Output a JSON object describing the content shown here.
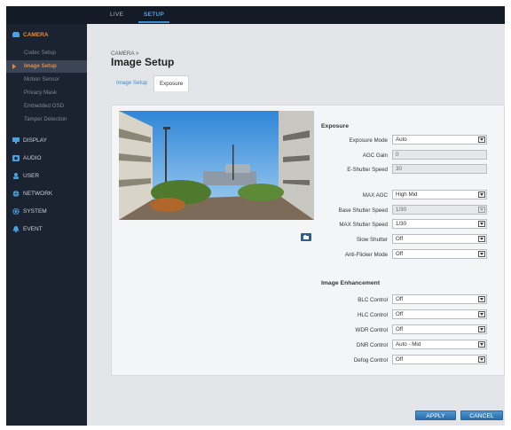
{
  "top_tabs": [
    {
      "label": "LIVE",
      "active": false
    },
    {
      "label": "SETUP",
      "active": true
    }
  ],
  "sidebar": {
    "camera": {
      "label": "CAMERA",
      "items": [
        "Codec Setup",
        "Image Setup",
        "Motion Sensor",
        "Privacy Mask",
        "Embedded OSD",
        "Tamper Detection"
      ],
      "active_item": "Image Setup"
    },
    "sections": [
      "DISPLAY",
      "AUDIO",
      "USER",
      "NETWORK",
      "SYSTEM",
      "EVENT"
    ]
  },
  "page": {
    "breadcrumb": "CAMERA >",
    "title": "Image Setup",
    "tabs": [
      {
        "label": "Image Setup",
        "active": false
      },
      {
        "label": "Exposure",
        "active": true
      }
    ]
  },
  "exposure": {
    "heading": "Exposure",
    "fields": [
      {
        "label": "Exposure Mode",
        "value": "Auto",
        "type": "select"
      },
      {
        "label": "AGC Gain",
        "value": "0",
        "type": "readonly"
      },
      {
        "label": "E-Shutter Speed",
        "value": "30",
        "type": "readonly"
      },
      {
        "label": "MAX AGC",
        "value": "High Mid",
        "type": "select"
      },
      {
        "label": "Base Shutter Speed",
        "value": "1/30",
        "type": "select-disabled"
      },
      {
        "label": "MAX Shutter Speed",
        "value": "1/30",
        "type": "select"
      },
      {
        "label": "Slow Shutter",
        "value": "Off",
        "type": "select"
      },
      {
        "label": "Anti-Flicker Mode",
        "value": "Off",
        "type": "select"
      }
    ]
  },
  "enhancement": {
    "heading": "Image Enhancement",
    "fields": [
      {
        "label": "BLC Control",
        "value": "Off"
      },
      {
        "label": "HLC Control",
        "value": "Off"
      },
      {
        "label": "WDR Control",
        "value": "Off"
      },
      {
        "label": "DNR Control",
        "value": "Auto - Mid"
      },
      {
        "label": "Defog Control",
        "value": "Off"
      }
    ]
  },
  "buttons": {
    "apply": "APPLY",
    "cancel": "CANCEL"
  },
  "colors": {
    "accent": "#3a8fd6",
    "active_menu": "#e88a3a",
    "topbar": "#141b26",
    "sidebar": "#1b2230",
    "content_bg": "#e3e5e9"
  }
}
